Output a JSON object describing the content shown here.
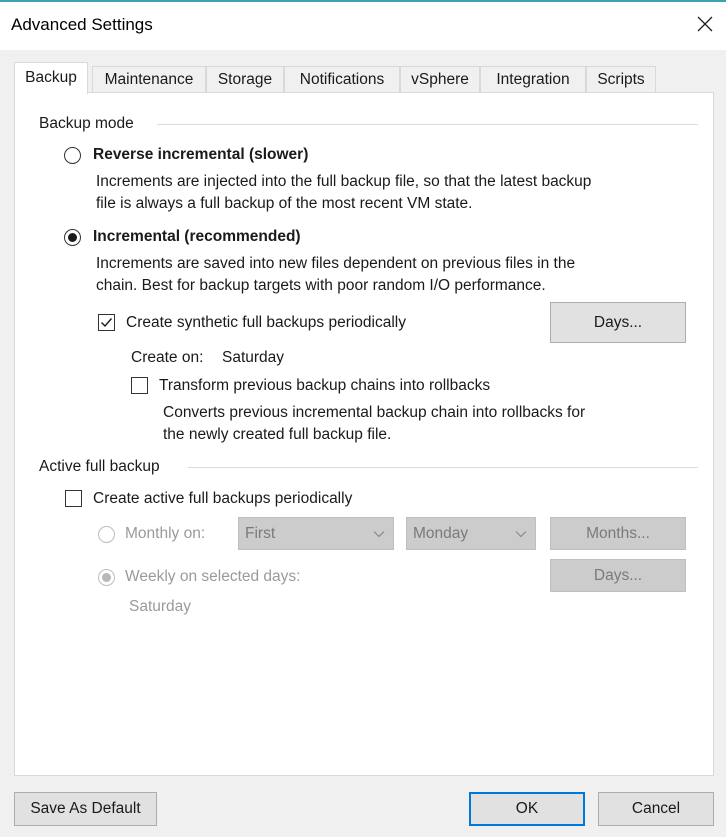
{
  "window": {
    "title": "Advanced Settings"
  },
  "tabs": [
    "Backup",
    "Maintenance",
    "Storage",
    "Notifications",
    "vSphere",
    "Integration",
    "Scripts"
  ],
  "active_tab": "Backup",
  "backup_mode": {
    "group_label": "Backup mode",
    "reverse": {
      "label": "Reverse incremental (slower)",
      "desc_line1": "Increments are injected into the full backup file, so that the latest backup",
      "desc_line2": "file is always a full backup of the most recent VM state.",
      "checked": false
    },
    "incremental": {
      "label": "Incremental (recommended)",
      "desc_line1": "Increments are saved into new files dependent on previous files in the",
      "desc_line2": "chain. Best for backup targets with poor random I/O performance.",
      "checked": true
    },
    "synthetic": {
      "label": "Create synthetic full backups periodically",
      "checked": true,
      "days_button": "Days...",
      "create_on_label": "Create on:",
      "create_on_value": "Saturday"
    },
    "transform": {
      "label": "Transform previous backup chains into rollbacks",
      "checked": false,
      "desc_line1": "Converts previous incremental backup chain into rollbacks for",
      "desc_line2": "the newly created full backup file."
    }
  },
  "active_full": {
    "group_label": "Active full backup",
    "create": {
      "label": "Create active full backups periodically",
      "checked": false
    },
    "monthly": {
      "label": "Monthly on:",
      "checked": false,
      "week_select": "First",
      "day_select": "Monday",
      "months_button": "Months..."
    },
    "weekly": {
      "label": "Weekly on selected days:",
      "checked": true,
      "days_button": "Days...",
      "days_value": "Saturday"
    }
  },
  "footer": {
    "save_default": "Save As Default",
    "ok": "OK",
    "cancel": "Cancel"
  },
  "colors": {
    "accent": "#0078d7",
    "title_bar": "#ffffff",
    "dialog_bg": "#f0f0f0",
    "disabled_text": "#9a9a9a"
  }
}
